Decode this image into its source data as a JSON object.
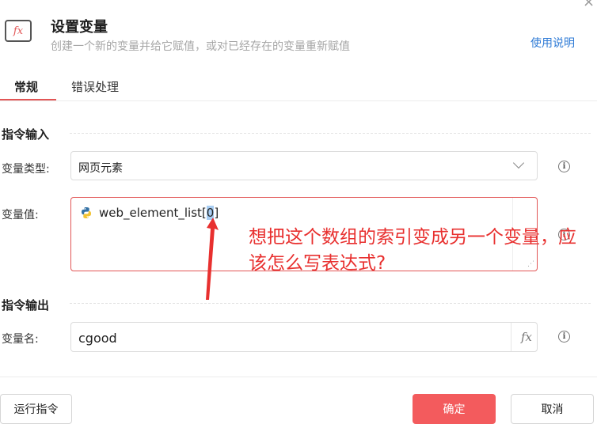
{
  "header": {
    "icon": "fx-icon",
    "icon_glyph": "fx",
    "title": "设置变量",
    "subtitle": "创建一个新的变量并给它赋值，或对已经存在的变量重新赋值",
    "help_link": "使用说明",
    "close_glyph": "×"
  },
  "tabs": [
    {
      "label": "常规",
      "active": true
    },
    {
      "label": "错误处理",
      "active": false
    }
  ],
  "input_section": {
    "title": "指令输入",
    "var_type_label": "变量类型:",
    "var_type_value": "网页元素",
    "var_value_label": "变量值:",
    "var_value_prefix": "web_element_list[",
    "var_value_selected": "0",
    "var_value_suffix": "]"
  },
  "output_section": {
    "title": "指令输出",
    "var_name_label": "变量名:",
    "var_name_value": "cgood",
    "fx_glyph": "fx"
  },
  "annotation": {
    "text": "想把这个数组的索引变成另一个变量，应该怎么写表达式?",
    "color": "#e8302f"
  },
  "footer": {
    "run_label": "运行指令",
    "ok_label": "确定",
    "cancel_label": "取消"
  },
  "colors": {
    "accent": "#f35b5d",
    "link": "#2f7bd6"
  }
}
